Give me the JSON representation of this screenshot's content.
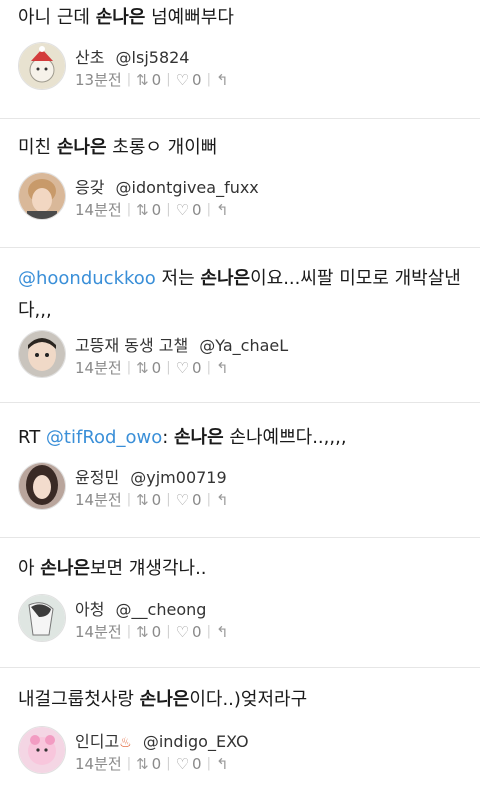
{
  "tweets": [
    {
      "text": [
        {
          "t": "아니 근데 "
        },
        {
          "t": "손나은",
          "kw": true
        },
        {
          "t": " 넘예뻐부다"
        }
      ],
      "display_name": "산초",
      "handle": "@lsj5824",
      "emoji": "",
      "time": "13분전",
      "retweets": "0",
      "likes": "0",
      "avatar_color": "#e8e2d0",
      "avatar_icon": "santa-hat-character"
    },
    {
      "text": [
        {
          "t": "미친 "
        },
        {
          "t": "손나은",
          "kw": true
        },
        {
          "t": " 초롱ㅇ 개이뻐"
        }
      ],
      "display_name": "응갖",
      "handle": "@idontgivea_fuxx",
      "emoji": "",
      "time": "14분전",
      "retweets": "0",
      "likes": "0",
      "avatar_color": "#d9b899",
      "avatar_icon": "person-photo"
    },
    {
      "text": [
        {
          "t": "@hoonduckkoo",
          "mention": true
        },
        {
          "t": " 저는 "
        },
        {
          "t": "손나은",
          "kw": true
        },
        {
          "t": "이요...씨팔 미모로 개박살낸다,,,"
        }
      ],
      "display_name": "고뜽재 동생 고챌",
      "handle": "@Ya_chaeL",
      "emoji": "",
      "time": "14분전",
      "retweets": "0",
      "likes": "0",
      "avatar_color": "#c9c4bd",
      "avatar_icon": "child-photo"
    },
    {
      "text": [
        {
          "t": "RT "
        },
        {
          "t": "@tifRod_owo",
          "mention": true
        },
        {
          "t": ": "
        },
        {
          "t": "손나은",
          "kw": true
        },
        {
          "t": " 손나예쁘다..,,,,"
        }
      ],
      "display_name": "윤정민",
      "handle": "@yjm00719",
      "emoji": "",
      "time": "14분전",
      "retweets": "0",
      "likes": "0",
      "avatar_color": "#b9a59c",
      "avatar_icon": "woman-photo"
    },
    {
      "text": [
        {
          "t": "아 "
        },
        {
          "t": "손나은",
          "kw": true
        },
        {
          "t": "보면 걔생각나.."
        }
      ],
      "display_name": "아청",
      "handle": "@__cheong",
      "emoji": "",
      "time": "14분전",
      "retweets": "0",
      "likes": "0",
      "avatar_color": "#dfe6e2",
      "avatar_icon": "illustration-photo"
    },
    {
      "text": [
        {
          "t": "내걸그룹첫사랑 "
        },
        {
          "t": "손나은",
          "kw": true
        },
        {
          "t": "이다..)엊저라구"
        }
      ],
      "display_name": "인디고",
      "handle": "@indigo_EXO",
      "emoji": "♨",
      "time": "14분전",
      "retweets": "0",
      "likes": "0",
      "avatar_color": "#f4d6e4",
      "avatar_icon": "pink-character"
    }
  ],
  "icons": {
    "retweet": "retweet-icon",
    "like": "heart-icon",
    "reply": "reply-icon"
  }
}
